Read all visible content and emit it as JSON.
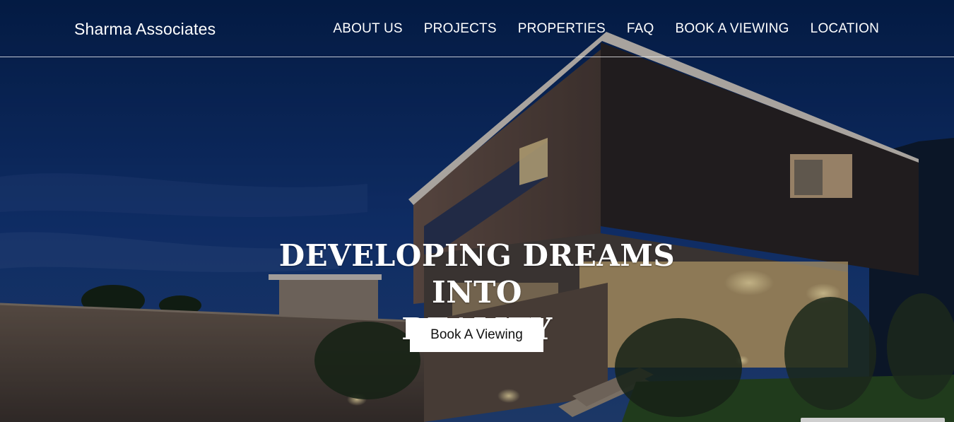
{
  "brand": {
    "name": "Sharma Associates"
  },
  "nav": {
    "items": [
      {
        "label": "ABOUT US"
      },
      {
        "label": "PROJECTS"
      },
      {
        "label": "PROPERTIES"
      },
      {
        "label": "FAQ"
      },
      {
        "label": "BOOK A VIEWING"
      },
      {
        "label": "LOCATION"
      }
    ]
  },
  "hero": {
    "headline_line1": "DEVELOPING DREAMS INTO",
    "headline_line2": "REALITY",
    "cta_label": "Book A Viewing"
  },
  "colors": {
    "sky_top": "#06224f",
    "sky_bottom": "#1b3e7a",
    "cta_bg": "#ffffff",
    "text": "#ffffff",
    "warm_light": "#f6d58a"
  }
}
